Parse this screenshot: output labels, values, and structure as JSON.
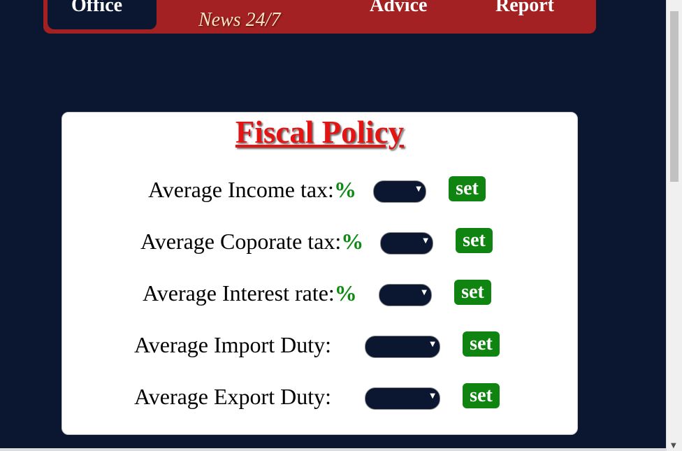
{
  "nav": {
    "office_label": "Office",
    "news_label": "News 24/7",
    "advice_label": "Advice",
    "report_label": "Report"
  },
  "card": {
    "title": "Fiscal Policy",
    "rows": [
      {
        "label": "Average Income tax:",
        "pct": "%",
        "button": "set"
      },
      {
        "label": "Average Coporate tax:",
        "pct": "%",
        "button": "set"
      },
      {
        "label": "Average Interest rate:",
        "pct": "%",
        "button": "set"
      },
      {
        "label": "Average Import Duty:",
        "pct": "",
        "button": "set"
      },
      {
        "label": "Average Export Duty:",
        "pct": "",
        "button": "set"
      }
    ]
  },
  "colors": {
    "background": "#0b1730",
    "nav_red": "#a32122",
    "title_red": "#e31414",
    "button_green": "#108410",
    "percent_green": "#0f8a14"
  },
  "icons": {
    "dropdown": "chevron-down-icon"
  }
}
